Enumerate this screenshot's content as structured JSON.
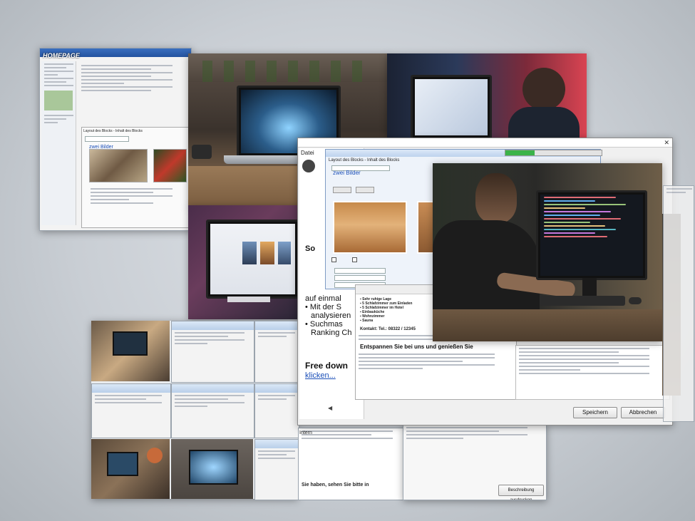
{
  "collage": {
    "top_left_window": {
      "logo_text": "HOMEPAGE",
      "images_label": "zwei Bilder",
      "block_title": "Layout des Blocks - Inhalt des Blocks"
    },
    "center_dialog": {
      "menu_label": "Datei",
      "block_title": "Layout des Blocks - Inhalt des Blocks",
      "images_label": "zwei Bilder",
      "left_fragments": [
        "auf einmal",
        "Mit der S",
        "analysieren",
        "Suchmas",
        "Ranking Ch"
      ],
      "left_letter": "So",
      "free_download": "Free down",
      "klicken": "klicken...",
      "editor": {
        "bullets": [
          "Sehr ruhige Lage",
          "5 Schlafzimmer zum Einladen",
          "5 Schlafzimmer im Hotel",
          "Einbauküche",
          "Wohnzimmer",
          "Sauna"
        ],
        "contact": "Kontakt: Tel.: 08322 / 12345",
        "heading": "Entspannen Sie bei uns und genießen Sie"
      },
      "save_button": "Speichern",
      "cancel_button": "Abbrechen",
      "intern_label": "Intern"
    },
    "bottom_right_window": {
      "print_button": "Beschreibung ausdrucken"
    },
    "bottom_center_snippet": {
      "text": "Sie haben, sehen Sie bitte in"
    }
  }
}
